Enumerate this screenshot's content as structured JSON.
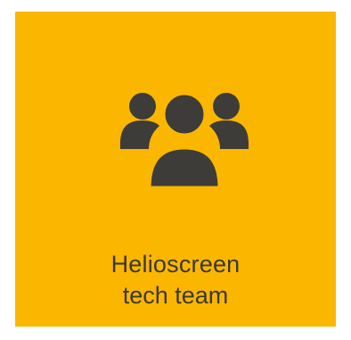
{
  "tile": {
    "background_color": "#FBB600",
    "icon": "team-icon",
    "icon_color": "#3E3C38",
    "title": "Helioscreen",
    "subtitle": "tech team"
  }
}
